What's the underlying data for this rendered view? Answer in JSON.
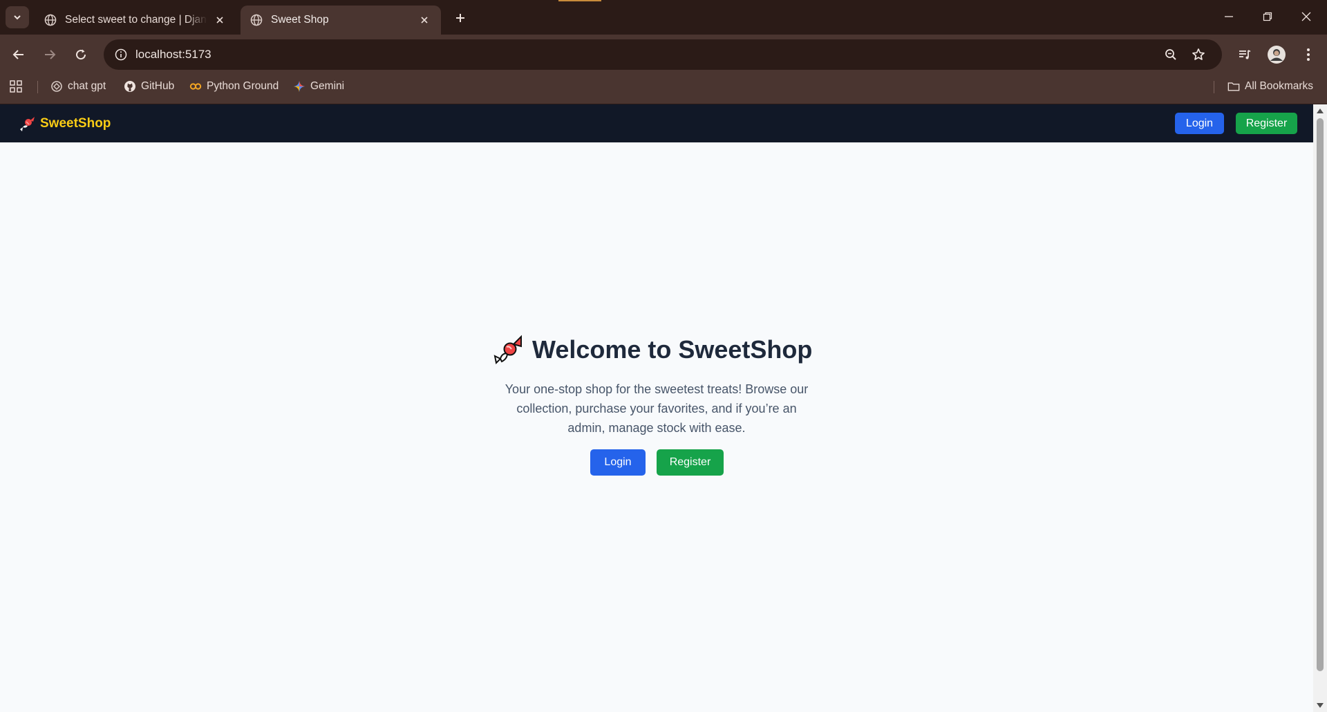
{
  "browser": {
    "tabs": [
      {
        "title": "Select sweet to change | Django",
        "active": false,
        "icon": "globe-icon"
      },
      {
        "title": "Sweet Shop",
        "active": true,
        "icon": "globe-icon"
      }
    ],
    "url": "localhost:5173",
    "bookmarks": [
      {
        "label": "chat gpt",
        "icon": "openai-icon"
      },
      {
        "label": "GitHub",
        "icon": "github-icon"
      },
      {
        "label": "Python Ground",
        "icon": "infinity-icon"
      },
      {
        "label": "Gemini",
        "icon": "gemini-icon"
      }
    ],
    "all_bookmarks": "All Bookmarks"
  },
  "site": {
    "brand": "SweetShop",
    "nav": {
      "login": "Login",
      "register": "Register"
    },
    "hero": {
      "title": "Welcome to SweetShop",
      "description": "Your one-stop shop for the sweetest treats! Browse our collection, purchase your favorites, and if you’re an admin, manage stock with ease.",
      "login": "Login",
      "register": "Register"
    }
  },
  "colors": {
    "nav_bg": "#111827",
    "brand": "#facc15",
    "login_btn": "#2563eb",
    "register_btn": "#16a34a",
    "page_bg": "#f8fafc"
  }
}
